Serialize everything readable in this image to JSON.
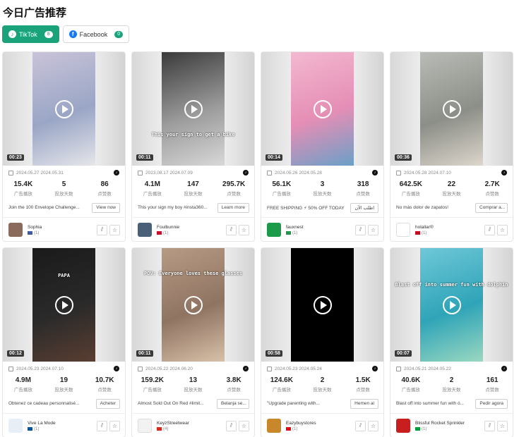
{
  "page_title": "今日广告推荐",
  "tabs": [
    {
      "label": "TikTok",
      "count": "8",
      "active": true
    },
    {
      "label": "Facebook",
      "count": "0",
      "active": false
    }
  ],
  "labels": {
    "impressions": "广告播放",
    "days": "投放天数",
    "likes": "点赞数"
  },
  "cards": [
    {
      "duration": "00:23",
      "overlay": "",
      "start": "2024.05.27",
      "end": "2024.05.31",
      "impressions": "15.4K",
      "days": "5",
      "likes": "86",
      "desc": "Join the 100 Envelope Challenge...",
      "cta": "View now",
      "advertiser": "Sophia",
      "count": "(1)",
      "thumb_colors": [
        "#c9c3d8",
        "#9aa6c6",
        "#e6e6ea"
      ],
      "avatar_color": "#8a6a5a"
    },
    {
      "duration": "00:11",
      "overlay": "This your sign to get a bike",
      "start": "2023.08.17",
      "end": "2024.07.09",
      "impressions": "4.1M",
      "days": "147",
      "likes": "295.7K",
      "desc": "This your sign my boy #insta360...",
      "cta": "Learn more",
      "advertiser": "Foulbunnie",
      "count": "(1)",
      "thumb_colors": [
        "#3a3a3a",
        "#9c9c9c",
        "#d8d8d8"
      ],
      "avatar_color": "#4a6078"
    },
    {
      "duration": "00:14",
      "overlay": "",
      "start": "2024.05.26",
      "end": "2024.05.28",
      "impressions": "56.1K",
      "days": "3",
      "likes": "318",
      "desc": "FREE SHIPPING ⚡ 50% OFF TODAY",
      "cta": "اطلب الآن",
      "advertiser": "fauxnest",
      "count": "(1)",
      "thumb_colors": [
        "#f3b8d0",
        "#e58eb5",
        "#6aa0c8"
      ],
      "avatar_color": "#1b9a4a"
    },
    {
      "duration": "00:36",
      "overlay": "",
      "start": "2024.05.28",
      "end": "2024.07.10",
      "impressions": "642.5K",
      "days": "22",
      "likes": "2.7K",
      "desc": "No más dolor de zapatos!",
      "cta": "Comprar a...",
      "advertiser": "holallar®",
      "count": "(1)",
      "thumb_colors": [
        "#b9bcb6",
        "#8c8f88",
        "#ddd6cc"
      ],
      "avatar_color": "#ffffff"
    },
    {
      "duration": "00:12",
      "overlay": "PAPA",
      "start": "2024.05.23",
      "end": "2024.07.10",
      "impressions": "4.9M",
      "days": "19",
      "likes": "10.7K",
      "desc": "Obtenez ce cadeau personnalisé...",
      "cta": "Acheter",
      "advertiser": "Vive La Mode",
      "count": "(1)",
      "thumb_colors": [
        "#1a1a1a",
        "#2a2a2a",
        "#5a3e32"
      ],
      "avatar_color": "#e8eef5"
    },
    {
      "duration": "00:11",
      "overlay": "POV: Everyone loves these glasses",
      "start": "2024.05.22",
      "end": "2024.06.20",
      "impressions": "159.2K",
      "days": "13",
      "likes": "3.8K",
      "desc": "Almost Sold Out On Red #limit...",
      "cta": "Belanja se...",
      "advertiser": "KeyzStreetwear",
      "count": "(4)",
      "thumb_colors": [
        "#b79a84",
        "#8f7462",
        "#d8c0a8"
      ],
      "avatar_color": "#f2f2f2"
    },
    {
      "duration": "00:58",
      "overlay": "",
      "start": "2024.05.23",
      "end": "2024.05.24",
      "impressions": "124.6K",
      "days": "2",
      "likes": "1.5K",
      "desc": "\"Upgrade parenting with...",
      "cta": "Hemen al",
      "advertiser": "Eazybuystores",
      "count": "(1)",
      "thumb_colors": [
        "#000000",
        "#000000",
        "#000000"
      ],
      "avatar_color": "#c8872a"
    },
    {
      "duration": "00:07",
      "overlay": "Blast off into summer fun with dolphin",
      "start": "2024.05.21",
      "end": "2024.05.22",
      "impressions": "40.6K",
      "days": "2",
      "likes": "161",
      "desc": "Blast off into summer fun with ó...",
      "cta": "Pedir agora",
      "advertiser": "Blissful Rocket Sprinkler",
      "count": "(1)",
      "thumb_colors": [
        "#6ec8d8",
        "#2fa4b8",
        "#9ad8c0"
      ],
      "avatar_color": "#c81e1e"
    }
  ]
}
